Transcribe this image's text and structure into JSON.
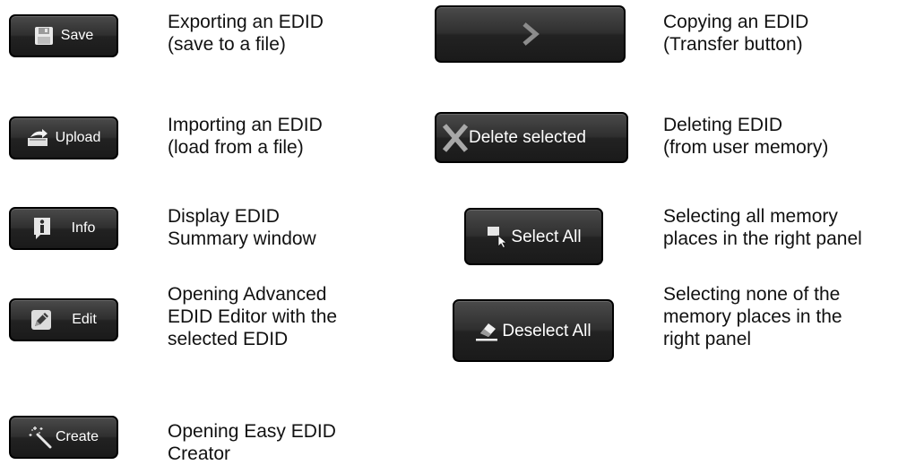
{
  "left_column": [
    {
      "button_label": "Save",
      "icon": "save-icon",
      "description": [
        "Exporting an EDID",
        "(save to a file)"
      ]
    },
    {
      "button_label": "Upload",
      "icon": "upload-icon",
      "description": [
        "Importing an EDID",
        "(load from a file)"
      ]
    },
    {
      "button_label": "Info",
      "icon": "info-icon",
      "description": [
        "Display EDID",
        "Summary window"
      ]
    },
    {
      "button_label": "Edit",
      "icon": "pencil-icon",
      "description": [
        "Opening Advanced",
        "EDID Editor with the",
        "selected EDID"
      ]
    },
    {
      "button_label": "Create",
      "icon": "magic-wand-icon",
      "description": [
        "Opening Easy EDID",
        "Creator"
      ]
    }
  ],
  "right_column": [
    {
      "button_label": "",
      "icon": "chevron-right-icon",
      "description": [
        "Copying an EDID",
        "(Transfer button)"
      ]
    },
    {
      "button_label": "Delete selected",
      "icon": "x-icon",
      "description": [
        "Deleting EDID",
        "(from user memory)"
      ]
    },
    {
      "button_label": "Select All",
      "icon": "select-cursor-icon",
      "description": [
        "Selecting all memory",
        "places in the right panel"
      ]
    },
    {
      "button_label": "Deselect All",
      "icon": "eraser-icon",
      "description": [
        "Selecting none of the",
        "memory places in the",
        "right panel"
      ]
    }
  ],
  "colors": {
    "button_bg": "#2b2b2b",
    "button_border": "#000000",
    "button_text": "#ffffff",
    "description_text": "#111111"
  }
}
